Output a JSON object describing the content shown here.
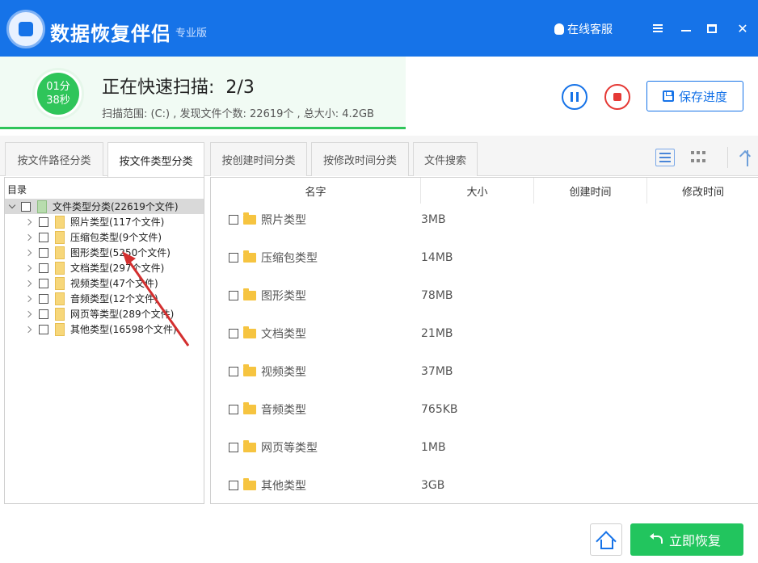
{
  "app": {
    "title": "数据恢复伴侣",
    "edition": "专业版",
    "support_label": "在线客服"
  },
  "scan": {
    "timer_minutes": "01分",
    "timer_seconds": "38秒",
    "status": "正在快速扫描:",
    "progress": "2/3",
    "info": "扫描范围: (C:) , 发现文件个数: 22619个 , 总大小: 4.2GB",
    "save_label": "保存进度"
  },
  "tabs": [
    {
      "label": "按文件路径分类"
    },
    {
      "label": "按文件类型分类"
    },
    {
      "label": "按创建时间分类"
    },
    {
      "label": "按修改时间分类"
    },
    {
      "label": "文件搜索"
    }
  ],
  "tree": {
    "header": "目录",
    "root": "文件类型分类(22619个文件)",
    "items": [
      {
        "label": "照片类型(117个文件)"
      },
      {
        "label": "压缩包类型(9个文件)"
      },
      {
        "label": "图形类型(5250个文件)"
      },
      {
        "label": "文档类型(297个文件)"
      },
      {
        "label": "视频类型(47个文件)"
      },
      {
        "label": "音频类型(12个文件)"
      },
      {
        "label": "网页等类型(289个文件)"
      },
      {
        "label": "其他类型(16598个文件)"
      }
    ]
  },
  "list": {
    "columns": [
      "名字",
      "大小",
      "创建时间",
      "修改时间"
    ],
    "rows": [
      {
        "name": "照片类型",
        "size": "3MB"
      },
      {
        "name": "压缩包类型",
        "size": "14MB"
      },
      {
        "name": "图形类型",
        "size": "78MB"
      },
      {
        "name": "文档类型",
        "size": "21MB"
      },
      {
        "name": "视频类型",
        "size": "37MB"
      },
      {
        "name": "音频类型",
        "size": "765KB"
      },
      {
        "name": "网页等类型",
        "size": "1MB"
      },
      {
        "name": "其他类型",
        "size": "3GB"
      }
    ]
  },
  "footer": {
    "recover_label": "立即恢复"
  },
  "colors": {
    "primary": "#1673e8",
    "success": "#22c55e",
    "danger": "#e53935",
    "annotation": "#d32f2f"
  }
}
